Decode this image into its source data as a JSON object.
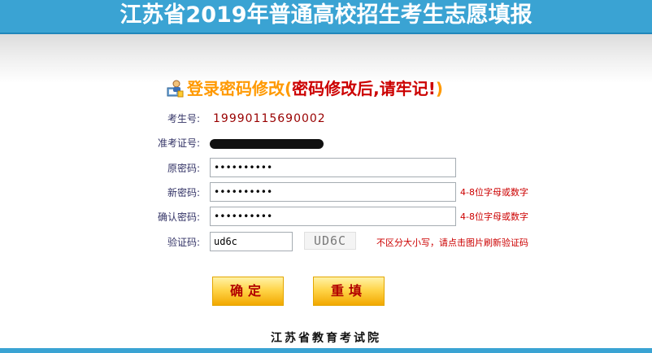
{
  "banner": {
    "title": "江苏省2019年普通高校招生考生志愿填报"
  },
  "heading": {
    "main": "登录密码修改",
    "paren_open": "(",
    "sub": "密码修改后,请牢记!",
    "paren_close": ")"
  },
  "form": {
    "exam_no": {
      "label": "考生号:",
      "value": "19990115690002"
    },
    "admission_no": {
      "label": "准考证号:"
    },
    "old_password": {
      "label": "原密码:",
      "value": "••••••••••"
    },
    "new_password": {
      "label": "新密码:",
      "value": "••••••••••",
      "hint": "4-8位字母或数字"
    },
    "confirm_password": {
      "label": "确认密码:",
      "value": "••••••••••",
      "hint": "4-8位字母或数字"
    },
    "captcha": {
      "label": "验证码:",
      "value": "ud6c",
      "image_text": "UD6C",
      "hint": "不区分大小写，请点击图片刷新验证码"
    }
  },
  "buttons": {
    "confirm": "确定",
    "reset": "重填"
  },
  "footer": {
    "org": "江苏省教育考试院"
  },
  "colors": {
    "banner": "#3aa3d3",
    "heading_main": "#ff9900",
    "heading_sub": "#cc0000",
    "value": "#990000",
    "hint": "#cc0000"
  }
}
